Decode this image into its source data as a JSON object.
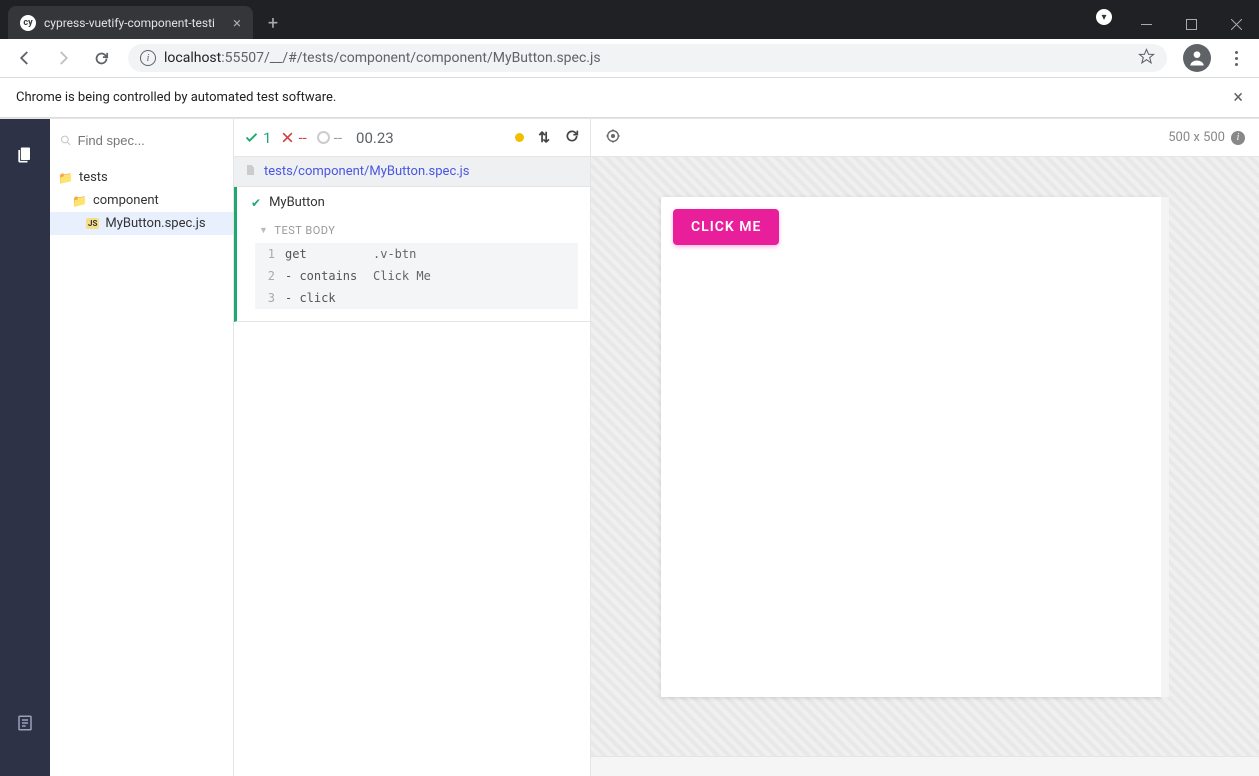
{
  "browser": {
    "tab_title": "cypress-vuetify-component-testi",
    "tab_favicon_text": "cy",
    "url_host": "localhost",
    "url_port": ":55507",
    "url_path": "/__/#/tests/component/component/MyButton.spec.js"
  },
  "infobar": {
    "message": "Chrome is being controlled by automated test software."
  },
  "spec_search": {
    "placeholder": "Find spec..."
  },
  "tree": {
    "root": "tests",
    "folder": "component",
    "file": "MyButton.spec.js",
    "file_badge": "JS"
  },
  "reporter": {
    "pass_count": "1",
    "fail_count": "--",
    "pending_count": "--",
    "duration": "00.23",
    "file_path": "tests/component/MyButton.spec.js",
    "test_name": "MyButton",
    "body_label": "TEST BODY",
    "commands": [
      {
        "n": "1",
        "name": "get",
        "msg": ".v-btn"
      },
      {
        "n": "2",
        "name": "- contains",
        "msg": "Click Me"
      },
      {
        "n": "3",
        "name": "- click",
        "msg": ""
      }
    ]
  },
  "preview": {
    "dimensions": "500 x 500",
    "button_label": "CLICK ME"
  }
}
